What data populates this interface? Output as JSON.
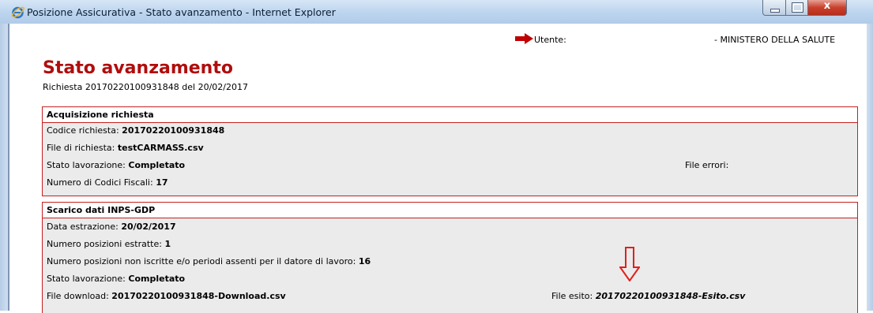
{
  "window": {
    "title": "Posizione Assicurativa - Stato avanzamento - Internet Explorer"
  },
  "header": {
    "user_label": "Utente:",
    "organization": "- MINISTERO DELLA SALUTE"
  },
  "page": {
    "title": "Stato avanzamento",
    "subtitle": "Richiesta 20170220100931848 del 20/02/2017"
  },
  "acquisizione": {
    "heading": "Acquisizione richiesta",
    "codice_label": "Codice richiesta: ",
    "codice_value": "20170220100931848",
    "file_label": "File di richiesta: ",
    "file_value": "testCARMASS.csv",
    "stato_label": "Stato lavorazione: ",
    "stato_value": "Completato",
    "numero_label": "Numero di Codici Fiscali: ",
    "numero_value": "17",
    "file_errori_label": "File errori:"
  },
  "scarico": {
    "heading": "Scarico dati INPS-GDP",
    "data_label": "Data estrazione: ",
    "data_value": "20/02/2017",
    "posizioni_label": "Numero posizioni estratte: ",
    "posizioni_value": "1",
    "non_iscritte_label": "Numero posizioni non iscritte e/o periodi assenti per il datore di lavoro: ",
    "non_iscritte_value": "16",
    "stato_label": "Stato lavorazione: ",
    "stato_value": "Completato",
    "download_label": "File download: ",
    "download_value": "20170220100931848-Download.csv",
    "esito_label": "File esito: ",
    "esito_value": "20170220100931848-Esito.csv"
  },
  "colors": {
    "title_red": "#b00d0d",
    "panel_border": "#c52020",
    "panel_body": "#ebebeb",
    "annotation_red": "#e0201a"
  },
  "icons": [
    "internet-explorer-icon",
    "right-arrow-icon",
    "down-arrow-annotation-icon"
  ]
}
